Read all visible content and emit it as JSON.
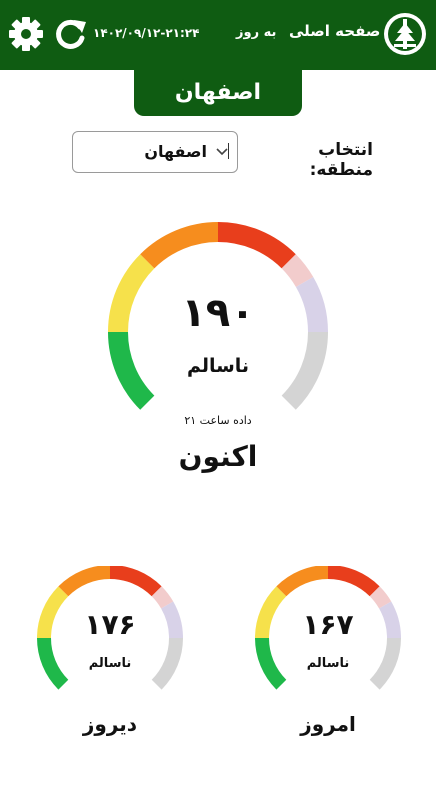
{
  "header": {
    "home_label": "صفحه اصلی",
    "update_label": "به روز",
    "datetime": "۱۴۰۲/۰۹/۱۲-۲۱:۲۴",
    "settings_icon": "gear-icon",
    "refresh_icon": "refresh-icon",
    "logo_icon": "environment-logo",
    "background": "#0f5c12"
  },
  "city_tab": {
    "label": "اصفهان"
  },
  "region": {
    "label": "انتخاب منطقه:",
    "selected": "اصفهان"
  },
  "gauge_colors": [
    "#1fb84a",
    "#f6e14b",
    "#f68d1e",
    "#e83e1c",
    "#f2cccc",
    "#d8d2e8",
    "#d4d4d4"
  ],
  "now": {
    "value_text": "۱۹۰",
    "value": 190,
    "status": "ناسالم",
    "hour_note": "داده ساعت ۲۱",
    "label": "اکنون"
  },
  "today": {
    "value_text": "۱۶۷",
    "value": 167,
    "status": "ناسالم",
    "label": "امروز"
  },
  "yesterday": {
    "value_text": "۱۷۶",
    "value": 176,
    "status": "ناسالم",
    "label": "دیروز"
  }
}
